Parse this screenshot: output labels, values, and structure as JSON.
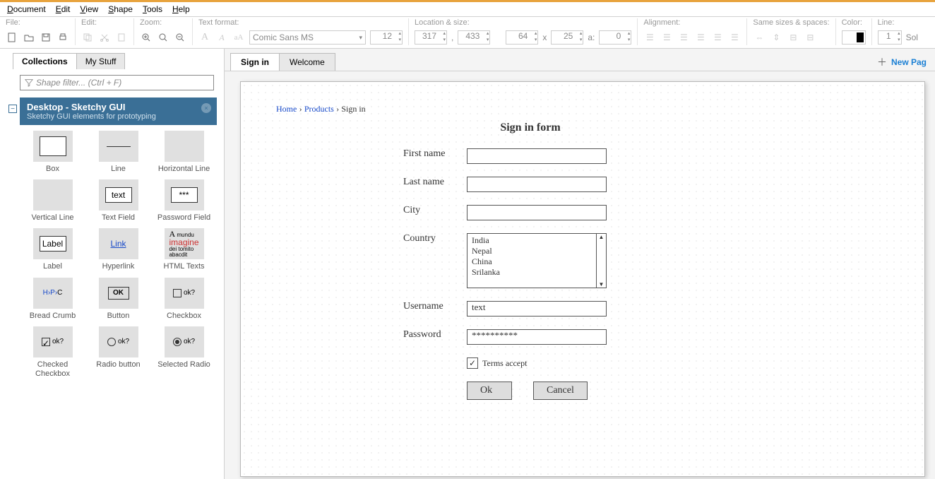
{
  "menu": [
    "Document",
    "Edit",
    "View",
    "Shape",
    "Tools",
    "Help"
  ],
  "toolbar": {
    "file": "File:",
    "edit": "Edit:",
    "zoom": "Zoom:",
    "textformat": "Text format:",
    "font": "Comic Sans MS",
    "fontsize": "12",
    "location": "Location & size:",
    "x": "317",
    "y": "433",
    "w": "64",
    "h": "25",
    "a": "0",
    "alabel": "a:",
    "xsep": ",",
    "wsep": "x",
    "alignment": "Alignment:",
    "samesizes": "Same sizes & spaces:",
    "color": "Color:",
    "line": "Line:",
    "lineval": "1",
    "linestyle": "Sol"
  },
  "leftTabs": {
    "a": "Collections",
    "b": "My Stuff"
  },
  "shapeFilter": "Shape filter... (Ctrl + F)",
  "collection": {
    "title": "Desktop - Sketchy GUI",
    "sub": "Sketchy GUI elements for prototyping"
  },
  "shapes": [
    {
      "lbl": "Box",
      "t": "box"
    },
    {
      "lbl": "Line",
      "t": "line"
    },
    {
      "lbl": "Horizontal Line",
      "t": "blank"
    },
    {
      "lbl": "Vertical Line",
      "t": "blank"
    },
    {
      "lbl": "Text Field",
      "t": "txt",
      "v": "text"
    },
    {
      "lbl": "Password Field",
      "t": "txt",
      "v": "***"
    },
    {
      "lbl": "Label",
      "t": "txt",
      "v": "Label"
    },
    {
      "lbl": "Hyperlink",
      "t": "link",
      "v": "Link"
    },
    {
      "lbl": "HTML Texts",
      "t": "html"
    },
    {
      "lbl": "Bread Crumb",
      "t": "bc"
    },
    {
      "lbl": "Button",
      "t": "btn",
      "v": "OK"
    },
    {
      "lbl": "Checkbox",
      "t": "chk",
      "v": "ok?"
    },
    {
      "lbl": "Checked Checkbox",
      "t": "chkc",
      "v": "ok?"
    },
    {
      "lbl": "Radio button",
      "t": "rad",
      "v": "ok?"
    },
    {
      "lbl": "Selected Radio",
      "t": "radc",
      "v": "ok?"
    }
  ],
  "docTabs": {
    "a": "Sign in",
    "b": "Welcome",
    "new": "New Pag"
  },
  "canvas": {
    "breadcrumb": {
      "home": "Home",
      "products": "Products",
      "current": "Sign in",
      "sep": "›"
    },
    "title": "Sign in form",
    "labels": {
      "first": "First name",
      "last": "Last name",
      "city": "City",
      "country": "Country",
      "user": "Username",
      "pass": "Password",
      "terms": "Terms accept"
    },
    "countries": [
      "India",
      "Nepal",
      "China",
      "Srilanka"
    ],
    "userval": "text",
    "passval": "**********",
    "ok": "Ok",
    "cancel": "Cancel"
  }
}
